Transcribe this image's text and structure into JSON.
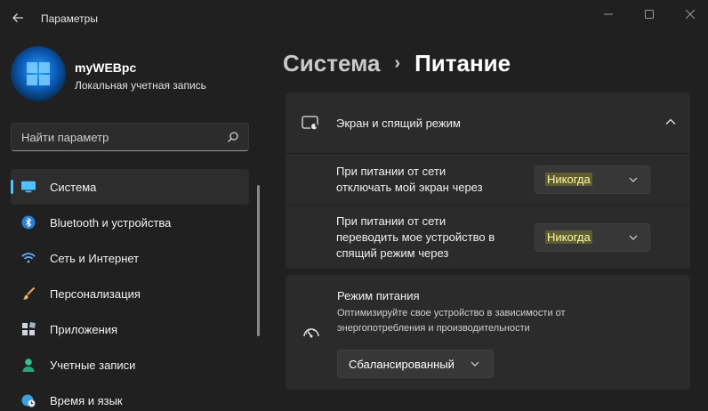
{
  "window": {
    "title": "Параметры",
    "back_icon": "back-arrow-icon",
    "controls": [
      "minimize-icon",
      "maximize-icon",
      "close-icon"
    ]
  },
  "user": {
    "name": "myWEBpc",
    "account_type": "Локальная учетная запись"
  },
  "search": {
    "placeholder": "Найти параметр",
    "icon": "search-icon"
  },
  "sidebar": {
    "accent_color": "#4cc2ff",
    "items": [
      {
        "label": "Система",
        "icon": "monitor-icon",
        "active": true
      },
      {
        "label": "Bluetooth и устройства",
        "icon": "bluetooth-icon",
        "active": false
      },
      {
        "label": "Сеть и Интернет",
        "icon": "wifi-icon",
        "active": false
      },
      {
        "label": "Персонализация",
        "icon": "brush-icon",
        "active": false
      },
      {
        "label": "Приложения",
        "icon": "apps-icon",
        "active": false
      },
      {
        "label": "Учетные записи",
        "icon": "person-icon",
        "active": false
      },
      {
        "label": "Время и язык",
        "icon": "globe-clock-icon",
        "active": false
      }
    ]
  },
  "breadcrumb": {
    "parent": "Система",
    "separator": "›",
    "current": "Питание"
  },
  "screen_sleep": {
    "title": "Экран и спящий режим",
    "icon": "screen-sleep-icon",
    "expanded": true,
    "rows": [
      {
        "label_line1": "При питании от сети",
        "label_line2": "отключать мой экран через",
        "value": "Никогда"
      },
      {
        "label_line1": "При питании от сети",
        "label_line2": "переводить мое устройство в",
        "label_line3": "спящий режим через",
        "value": "Никогда"
      }
    ]
  },
  "power_mode": {
    "title": "Режим питания",
    "description": "Оптимизируйте свое устройство в зависимости от энергопотребления и производительности",
    "icon": "gauge-icon",
    "value": "Сбалансированный"
  },
  "colors": {
    "background": "#202020",
    "card": "#2b2b2b",
    "highlight": "#e6e628"
  }
}
